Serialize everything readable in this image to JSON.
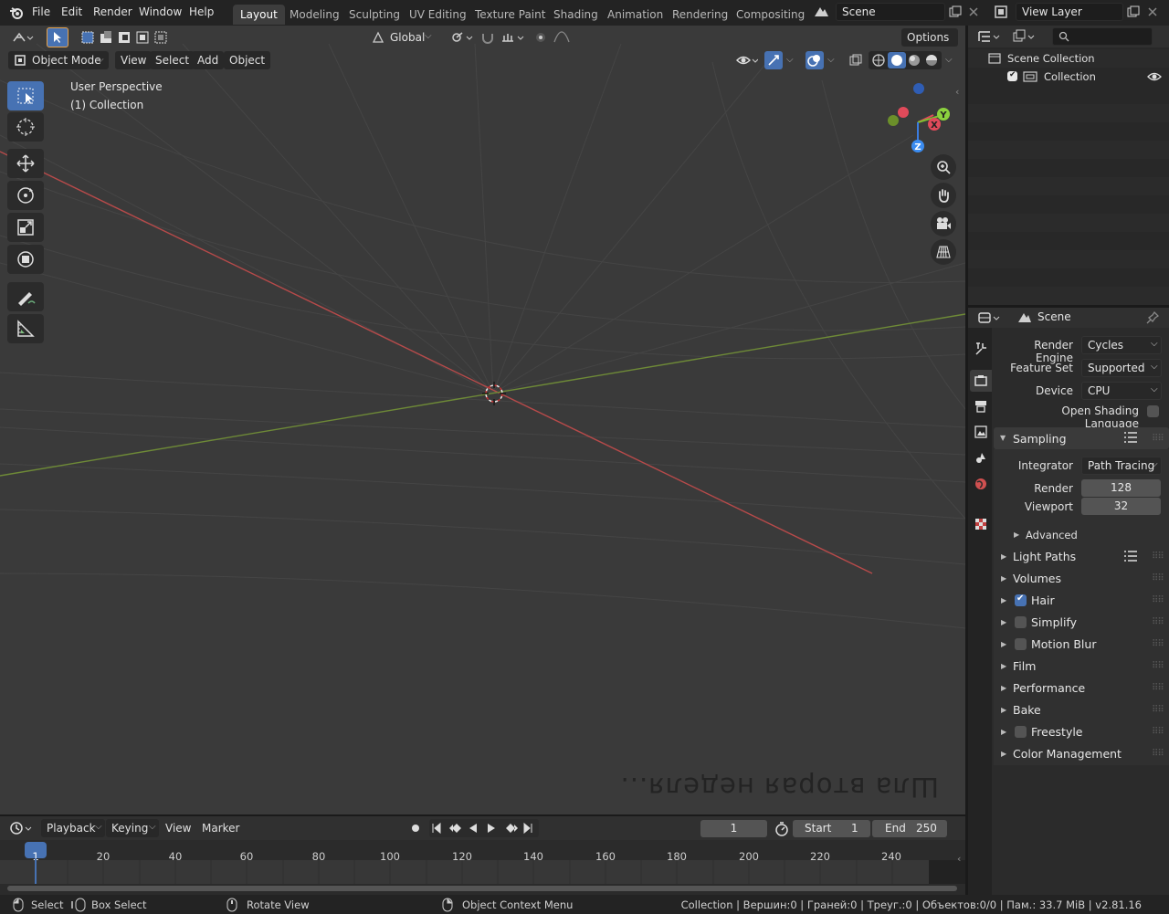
{
  "menubar": {
    "items": [
      "File",
      "Edit",
      "Render",
      "Window",
      "Help"
    ]
  },
  "workspaces": {
    "tabs": [
      "Layout",
      "Modeling",
      "Sculpting",
      "UV Editing",
      "Texture Paint",
      "Shading",
      "Animation",
      "Rendering",
      "Compositing"
    ],
    "active": "Layout"
  },
  "scene": {
    "name": "Scene"
  },
  "view_layer": {
    "name": "View Layer"
  },
  "viewport_header": {
    "mode": "Object Mode",
    "menus": [
      "View",
      "Select",
      "Add",
      "Object"
    ],
    "orientation": "Global",
    "options_label": "Options"
  },
  "viewport_overlay": {
    "perspective": "User Perspective",
    "collection": "(1) Collection",
    "watermark": "Шла вторая неделя..."
  },
  "gizmo": {
    "x_label": "X",
    "y_label": "Y",
    "z_label": "Z"
  },
  "outliner": {
    "root": "Scene Collection",
    "collection": "Collection"
  },
  "properties": {
    "context": "Scene",
    "render_engine_label": "Render Engine",
    "render_engine": "Cycles",
    "feature_set_label": "Feature Set",
    "feature_set": "Supported",
    "device_label": "Device",
    "device": "CPU",
    "osl_label": "Open Shading Language",
    "sampling": {
      "title": "Sampling",
      "integrator_label": "Integrator",
      "integrator": "Path Tracing",
      "render_label": "Render",
      "render": "128",
      "viewport_label": "Viewport",
      "viewport": "32",
      "advanced": "Advanced"
    },
    "panels": {
      "light_paths": "Light Paths",
      "volumes": "Volumes",
      "hair": "Hair",
      "simplify": "Simplify",
      "motion_blur": "Motion Blur",
      "film": "Film",
      "performance": "Performance",
      "bake": "Bake",
      "freestyle": "Freestyle",
      "color_management": "Color Management"
    }
  },
  "timeline": {
    "menus": [
      "Playback",
      "Keying",
      "View",
      "Marker"
    ],
    "current_frame": "1",
    "start_label": "Start",
    "start": "1",
    "end_label": "End",
    "end": "250",
    "ticks": [
      "1",
      "20",
      "40",
      "60",
      "80",
      "100",
      "120",
      "140",
      "160",
      "180",
      "200",
      "220",
      "240"
    ]
  },
  "statusbar": {
    "select": "Select",
    "box_select": "Box Select",
    "rotate_view": "Rotate View",
    "context_menu": "Object Context Menu",
    "stats": "Collection | Вершин:0 | Граней:0 | Треуг.:0 | Объектов:0/0 | Пам.: 33.7 MiB | v2.81.16"
  },
  "colors": {
    "accent": "#4772b3",
    "x_axis": "#c0403f",
    "y_axis": "#7fa23a",
    "z_axis": "#3b7ce0"
  }
}
